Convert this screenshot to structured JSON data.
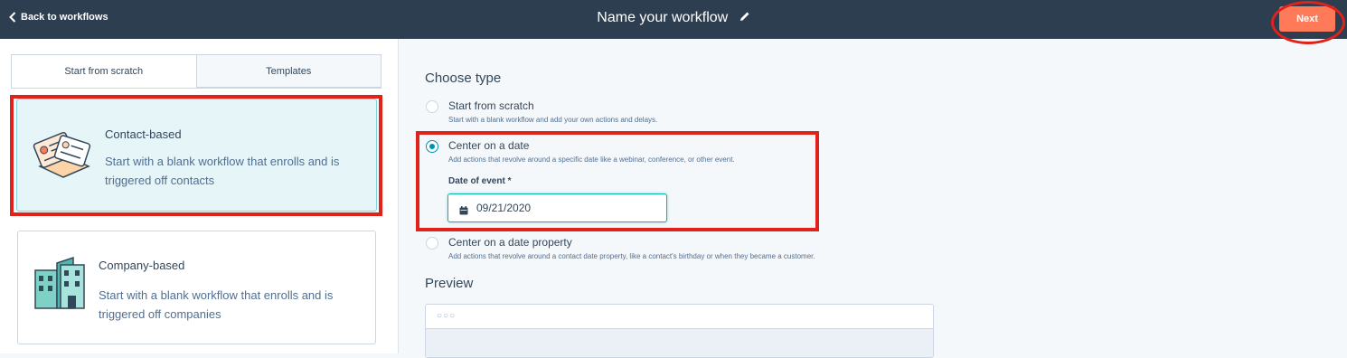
{
  "topbar": {
    "back_label": "Back to workflows",
    "title": "Name your workflow",
    "next_label": "Next"
  },
  "tabs": [
    {
      "label": "Start from scratch",
      "active": true
    },
    {
      "label": "Templates",
      "active": false
    }
  ],
  "cards": [
    {
      "title": "Contact-based",
      "description": "Start with a blank workflow that enrolls and is triggered off contacts",
      "selected": true,
      "icon": "contact-cards-icon"
    },
    {
      "title": "Company-based",
      "description": "Start with a blank workflow that enrolls and is triggered off companies",
      "selected": false,
      "icon": "buildings-icon"
    }
  ],
  "choose_type": {
    "heading": "Choose type",
    "options": [
      {
        "label": "Start from scratch",
        "description": "Start with a blank workflow and add your own actions and delays.",
        "checked": false
      },
      {
        "label": "Center on a date",
        "description": "Add actions that revolve around a specific date like a webinar, conference, or other event.",
        "checked": true
      },
      {
        "label": "Center on a date property",
        "description": "Add actions that revolve around a contact date property, like a contact's birthday or when they became a customer.",
        "checked": false
      }
    ],
    "date_field": {
      "label": "Date of event *",
      "value": "09/21/2020",
      "icon": "calendar-icon"
    }
  },
  "preview": {
    "heading": "Preview",
    "dots": "○○○"
  },
  "colors": {
    "topbar": "#2d3e50",
    "accent": "#ff7a59",
    "highlight": "#e0221b",
    "selected_card": "#e5f5f8",
    "radio": "#0091ae"
  }
}
